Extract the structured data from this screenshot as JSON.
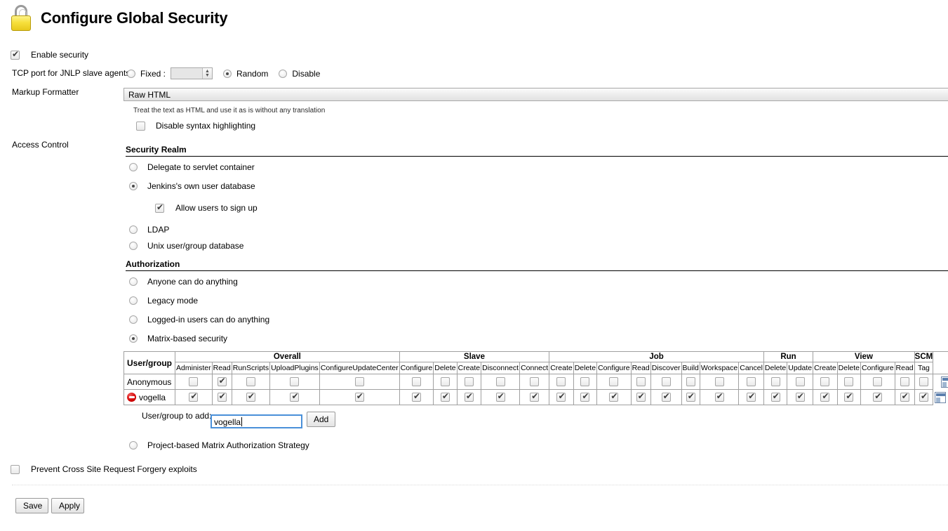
{
  "header": {
    "title": "Configure Global Security",
    "icon": "padlock-icon"
  },
  "enable_security": {
    "label": "Enable security",
    "checked": true
  },
  "jnlp": {
    "label": "TCP port for JNLP slave agents",
    "fixed_label": "Fixed :",
    "fixed_value": "",
    "random_label": "Random",
    "disable_label": "Disable",
    "selected": "Random"
  },
  "markup_formatter": {
    "label": "Markup Formatter",
    "selected": "Raw HTML",
    "options": [
      "Raw HTML"
    ],
    "help": "Treat the text as HTML and use it as is without any translation",
    "disable_syntax_label": "Disable syntax highlighting",
    "disable_syntax_checked": false
  },
  "access_control": {
    "label": "Access Control",
    "security_realm": {
      "heading": "Security Realm",
      "options": [
        {
          "label": "Delegate to servlet container",
          "selected": false
        },
        {
          "label": "Jenkins's own user database",
          "selected": true
        },
        {
          "label": "LDAP",
          "selected": false
        },
        {
          "label": "Unix user/group database",
          "selected": false
        }
      ],
      "allow_signup": {
        "label": "Allow users to sign up",
        "checked": true
      }
    },
    "authorization": {
      "heading": "Authorization",
      "options": [
        {
          "label": "Anyone can do anything",
          "selected": false
        },
        {
          "label": "Legacy mode",
          "selected": false
        },
        {
          "label": "Logged-in users can do anything",
          "selected": false
        },
        {
          "label": "Matrix-based security",
          "selected": true
        },
        {
          "label": "Project-based Matrix Authorization Strategy",
          "selected": false
        }
      ]
    }
  },
  "matrix": {
    "user_column_header": "User/group",
    "groups": [
      {
        "name": "Overall",
        "permissions": [
          "Administer",
          "Read",
          "RunScripts",
          "UploadPlugins",
          "ConfigureUpdateCenter"
        ]
      },
      {
        "name": "Slave",
        "permissions": [
          "Configure",
          "Delete",
          "Create",
          "Disconnect",
          "Connect"
        ]
      },
      {
        "name": "Job",
        "permissions": [
          "Create",
          "Delete",
          "Configure",
          "Read",
          "Discover",
          "Build",
          "Workspace",
          "Cancel"
        ]
      },
      {
        "name": "Run",
        "permissions": [
          "Delete",
          "Update"
        ]
      },
      {
        "name": "View",
        "permissions": [
          "Create",
          "Delete",
          "Configure",
          "Read"
        ]
      },
      {
        "name": "SCM",
        "permissions": [
          "Tag"
        ]
      }
    ],
    "rows": [
      {
        "user": "Anonymous",
        "has_user_icon": false,
        "has_delete": false,
        "values": [
          false,
          true,
          false,
          false,
          false,
          false,
          false,
          false,
          false,
          false,
          false,
          false,
          false,
          false,
          false,
          false,
          false,
          false,
          false,
          false,
          false,
          false,
          false,
          false,
          false
        ]
      },
      {
        "user": "vogella",
        "has_user_icon": true,
        "has_delete": true,
        "values": [
          true,
          true,
          true,
          true,
          true,
          true,
          true,
          true,
          true,
          true,
          true,
          true,
          true,
          true,
          true,
          true,
          true,
          true,
          true,
          true,
          true,
          true,
          true,
          true,
          true
        ]
      }
    ],
    "select_all_icon": "table-select-icon",
    "delete_row_icon": "delete-row-icon"
  },
  "add_user": {
    "label": "User/group to add:",
    "value": "vogella",
    "placeholder": "",
    "button_label": "Add"
  },
  "csrf": {
    "label": "Prevent Cross Site Request Forgery exploits",
    "checked": false
  },
  "footer": {
    "save_label": "Save",
    "apply_label": "Apply"
  }
}
